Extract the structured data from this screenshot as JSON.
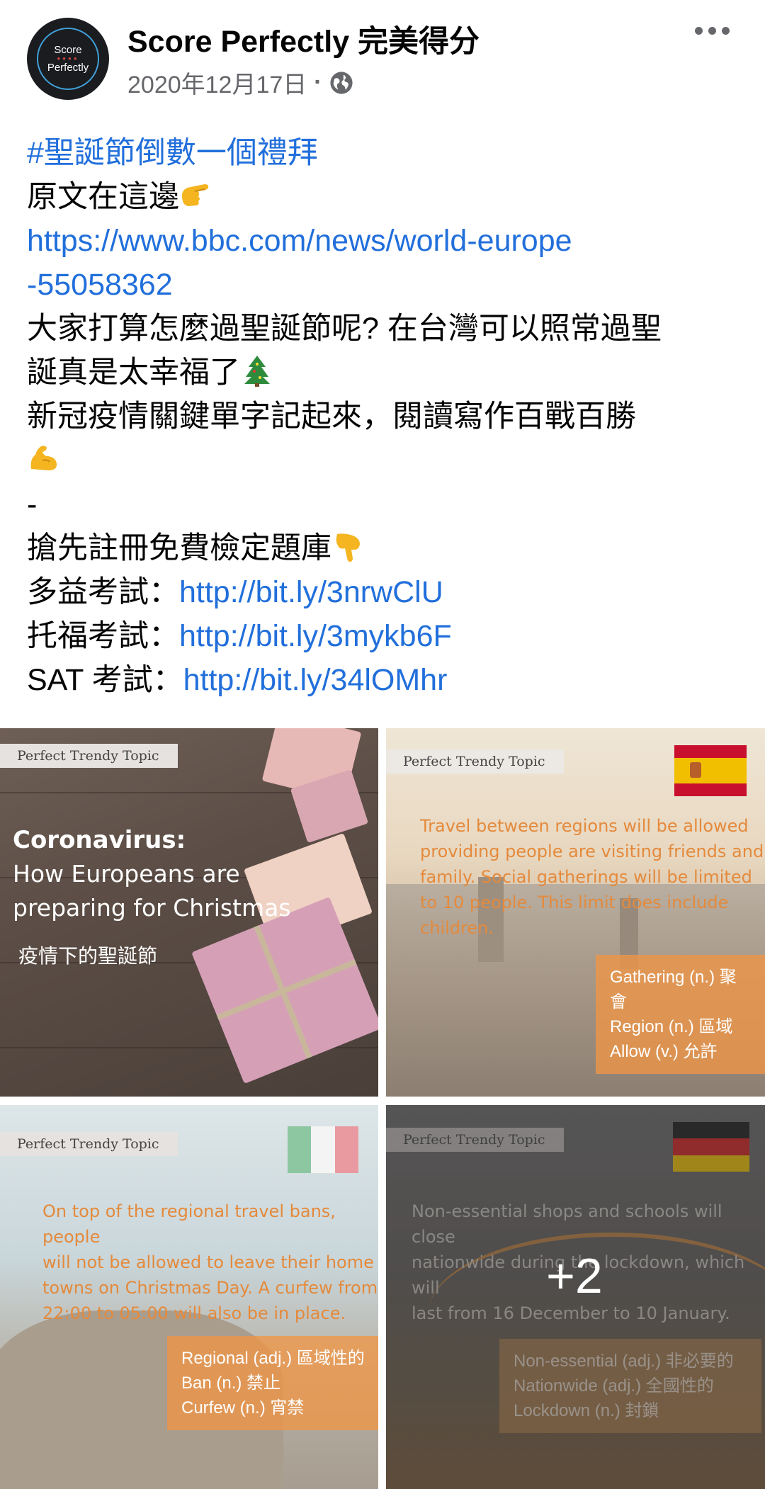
{
  "header": {
    "avatar_line1": "Score",
    "avatar_line2": "Perfectly",
    "page_name": "Score Perfectly 完美得分",
    "date": "2020年12月17日",
    "separator": "·",
    "icons": {
      "privacy": "globe-icon",
      "more": "more-horizontal-icon"
    }
  },
  "post": {
    "hashtag": "#聖誕節倒數一個禮拜",
    "line_original": "原文在這邊",
    "url_line1": "https://www.bbc.com/news/world-europe",
    "url_line2": "-55058362",
    "line3a": "大家打算怎麼過聖誕節呢? 在台灣可以照常過聖",
    "line3b": "誕真是太幸福了",
    "line4": "新冠疫情關鍵單字記起來，閱讀寫作百戰百勝",
    "dash": "-",
    "line_register": "搶先註冊免費檢定題庫",
    "links": [
      {
        "label": "多益考試：",
        "url": "http://bit.ly/3nrwClU"
      },
      {
        "label": "托福考試：",
        "url": "http://bit.ly/3mykb6F"
      },
      {
        "label": "SAT 考試：",
        "url": "http://bit.ly/34lOMhr"
      }
    ],
    "emojis": [
      "point-right-emoji",
      "christmas-tree-emoji",
      "flexed-biceps-emoji",
      "point-down-emoji"
    ]
  },
  "photos": {
    "tag": "Perfect Trendy Topic",
    "p1": {
      "title": "Coronavirus:",
      "subtitle1": "How Europeans are",
      "subtitle2": "preparing for Christmas",
      "chinese": "疫情下的聖誕節"
    },
    "p2": {
      "text": [
        "Travel between regions will be allowed",
        "providing people are visiting friends and",
        "family. Social gatherings will be limited",
        "to 10 people. This limit does include children."
      ],
      "vocab": [
        "Gathering (n.) 聚會",
        "Region (n.) 區域",
        "Allow (v.) 允許"
      ],
      "flag": "spain-flag"
    },
    "p3": {
      "text": [
        "On top of the regional travel bans, people",
        "will not be allowed to leave their home",
        "towns on Christmas Day.  A curfew from",
        "22:00 to 05:00 will also be in place."
      ],
      "vocab": [
        "Regional (adj.) 區域性的",
        "Ban (n.) 禁止",
        "Curfew (n.) 宵禁"
      ],
      "flag": "italy-flag"
    },
    "p4": {
      "text": [
        "Non-essential shops and schools will close",
        "nationwide during the lockdown, which will",
        "last from 16 December to 10 January."
      ],
      "vocab": [
        "Non-essential (adj.) 非必要的",
        "Nationwide (adj.) 全國性的",
        "Lockdown (n.) 封鎖"
      ],
      "flag": "germany-flag",
      "more_count": "+2"
    }
  },
  "colors": {
    "link": "#216fdb",
    "meta": "#65676b",
    "overlay_orange": "#f0964a"
  }
}
